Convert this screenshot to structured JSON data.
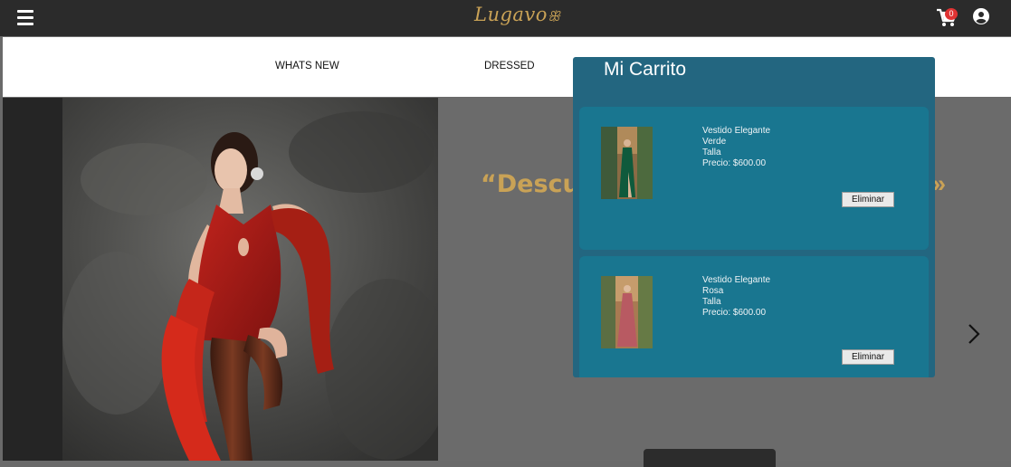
{
  "header": {
    "logo_text": "Lugavo",
    "logo_mark": "ꕥ",
    "cart_count": "0",
    "icons": [
      "hamburger-menu-icon",
      "shopping-cart-icon",
      "user-account-icon"
    ]
  },
  "nav": {
    "items": [
      "WHATS NEW",
      "DRESSED"
    ]
  },
  "hero": {
    "quote_fragment": "“Descu",
    "quote_tail": "»",
    "next_icon": "chevron-right-icon"
  },
  "cart": {
    "title": "Mi Carrito",
    "items": [
      {
        "name": "Vestido Elegante",
        "color": "Verde",
        "size_label": "Talla",
        "price": "Precio: $600.00",
        "remove_label": "Eliminar"
      },
      {
        "name": "Vestido Elegante",
        "color": "Rosa",
        "size_label": "Talla",
        "price": "Precio: $600.00",
        "remove_label": "Eliminar"
      }
    ]
  },
  "colors": {
    "topbar": "#2b2b2b",
    "gold": "#c9a256",
    "cart_panel": "#236680",
    "cart_item": "#197690",
    "badge": "#e03333"
  }
}
